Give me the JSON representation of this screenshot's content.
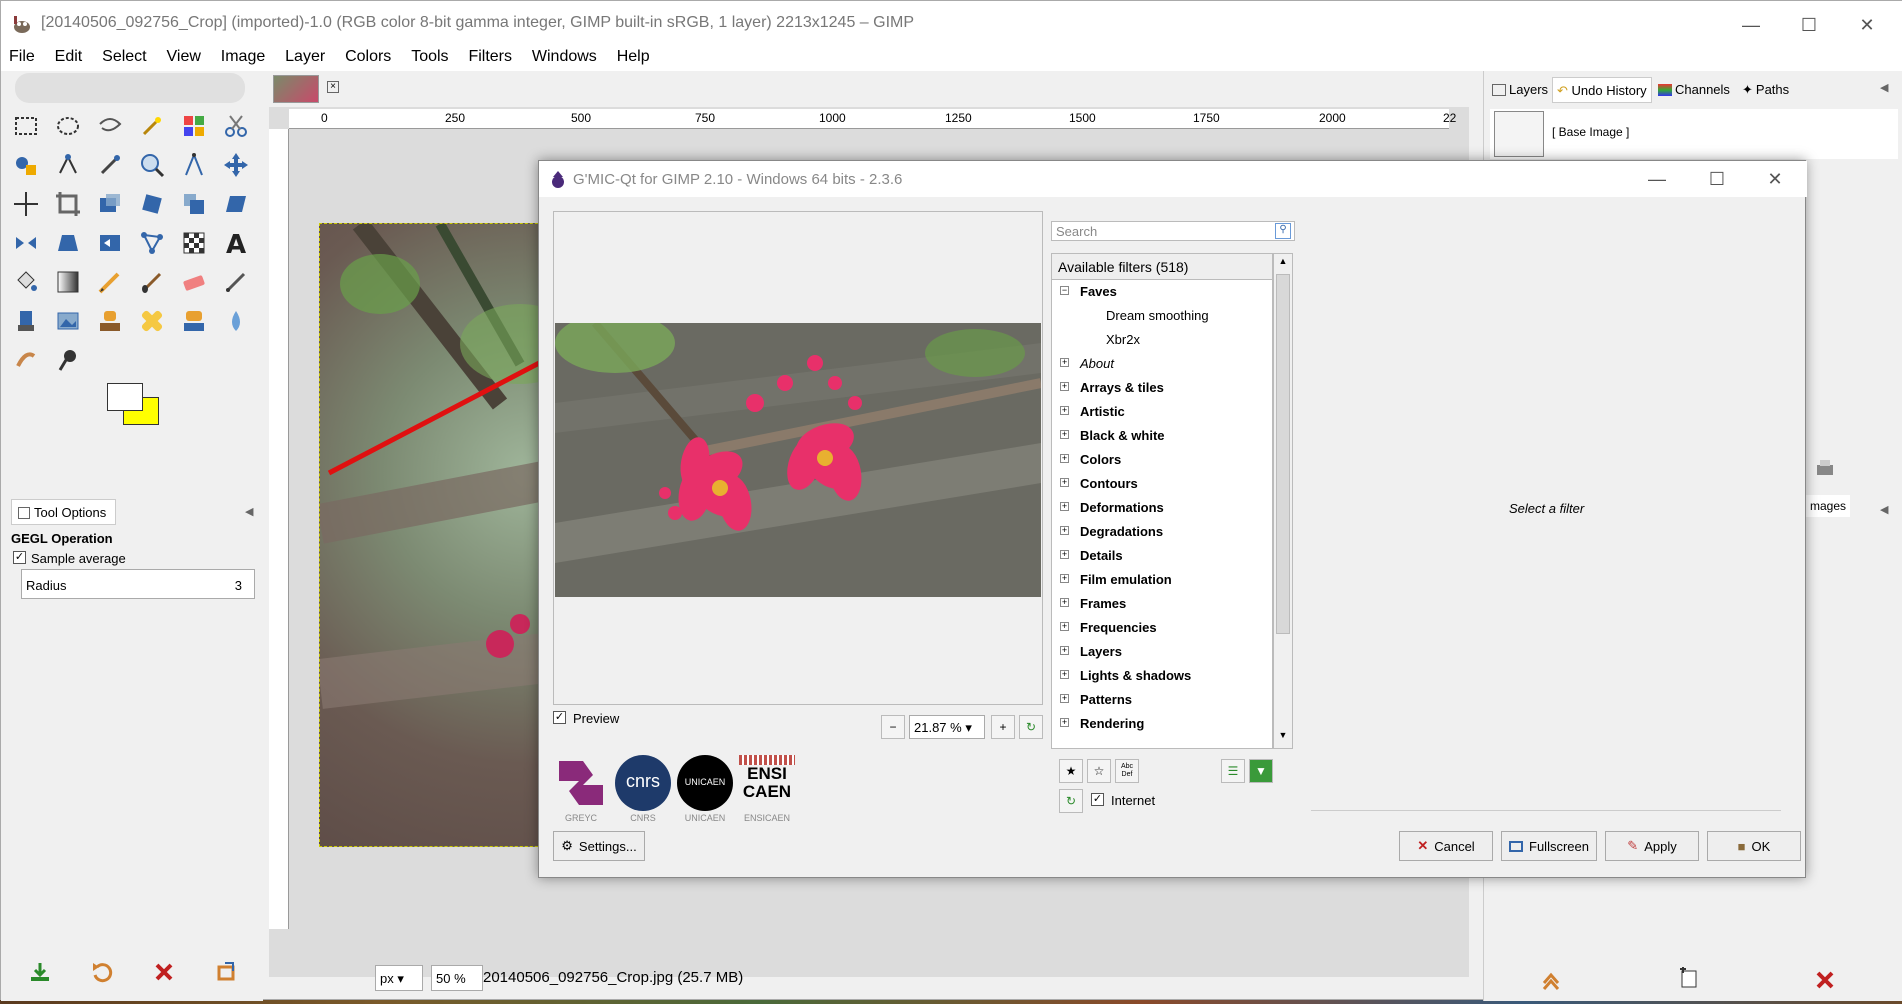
{
  "window": {
    "title": "[20140506_092756_Crop] (imported)-1.0 (RGB color 8-bit gamma integer, GIMP built-in sRGB, 1 layer) 2213x1245 – GIMP"
  },
  "menu": [
    "File",
    "Edit",
    "Select",
    "View",
    "Image",
    "Layer",
    "Colors",
    "Tools",
    "Filters",
    "Windows",
    "Help"
  ],
  "tool_options": {
    "tab_label": "Tool Options",
    "operation": "GEGL Operation",
    "sample_average_label": "Sample average",
    "sample_average_checked": true,
    "radius_label": "Radius",
    "radius_value": "3"
  },
  "ruler": {
    "marks": [
      "0",
      "250",
      "500",
      "750",
      "1000",
      "1250",
      "1500",
      "1750",
      "2000",
      "22"
    ]
  },
  "status": {
    "unit": "px",
    "zoom": "50 %",
    "file": "20140506_092756_Crop.jpg (25.7 MB)"
  },
  "dock": {
    "tabs": [
      "Layers",
      "Undo History",
      "Channels",
      "Paths"
    ],
    "base_image_label": "[ Base Image ]",
    "images_tab": "mages"
  },
  "gmic": {
    "title": "G'MIC-Qt for GIMP 2.10 - Windows 64 bits - 2.3.6",
    "search_placeholder": "Search",
    "filters_header": "Available filters (518)",
    "tree": [
      {
        "label": "Faves",
        "kind": "node",
        "expanded": true
      },
      {
        "label": "Dream smoothing",
        "kind": "leaf"
      },
      {
        "label": "Xbr2x",
        "kind": "leaf"
      },
      {
        "label": "About",
        "kind": "italic"
      },
      {
        "label": "Arrays & tiles",
        "kind": "node"
      },
      {
        "label": "Artistic",
        "kind": "node"
      },
      {
        "label": "Black & white",
        "kind": "node"
      },
      {
        "label": "Colors",
        "kind": "node"
      },
      {
        "label": "Contours",
        "kind": "node"
      },
      {
        "label": "Deformations",
        "kind": "node"
      },
      {
        "label": "Degradations",
        "kind": "node"
      },
      {
        "label": "Details",
        "kind": "node"
      },
      {
        "label": "Film emulation",
        "kind": "node"
      },
      {
        "label": "Frames",
        "kind": "node"
      },
      {
        "label": "Frequencies",
        "kind": "node"
      },
      {
        "label": "Layers",
        "kind": "node"
      },
      {
        "label": "Lights & shadows",
        "kind": "node"
      },
      {
        "label": "Patterns",
        "kind": "node"
      },
      {
        "label": "Rendering",
        "kind": "node"
      }
    ],
    "preview_label": "Preview",
    "preview_checked": true,
    "zoom_value": "21.87 %",
    "internet_label": "Internet",
    "internet_checked": true,
    "select_filter_text": "Select a filter",
    "settings_label": "Settings...",
    "logos": [
      "GREYC",
      "CNRS",
      "UNICAEN",
      "ENSICAEN"
    ],
    "buttons": {
      "cancel": "Cancel",
      "fullscreen": "Fullscreen",
      "apply": "Apply",
      "ok": "OK"
    },
    "logo_labels": {
      "cnrs": "cnrs",
      "unicaen": "UNICAEN",
      "ensi_line1": "ENSI",
      "ensi_line2": "CAEN",
      "def_icon_top": "Abc",
      "def_icon_bottom": "Def"
    }
  },
  "colors": {
    "annotation_arrow": "#e01010",
    "foreground_swatch": "#ffffff",
    "background_swatch": "#ffff00",
    "flower": "#e8306a"
  }
}
